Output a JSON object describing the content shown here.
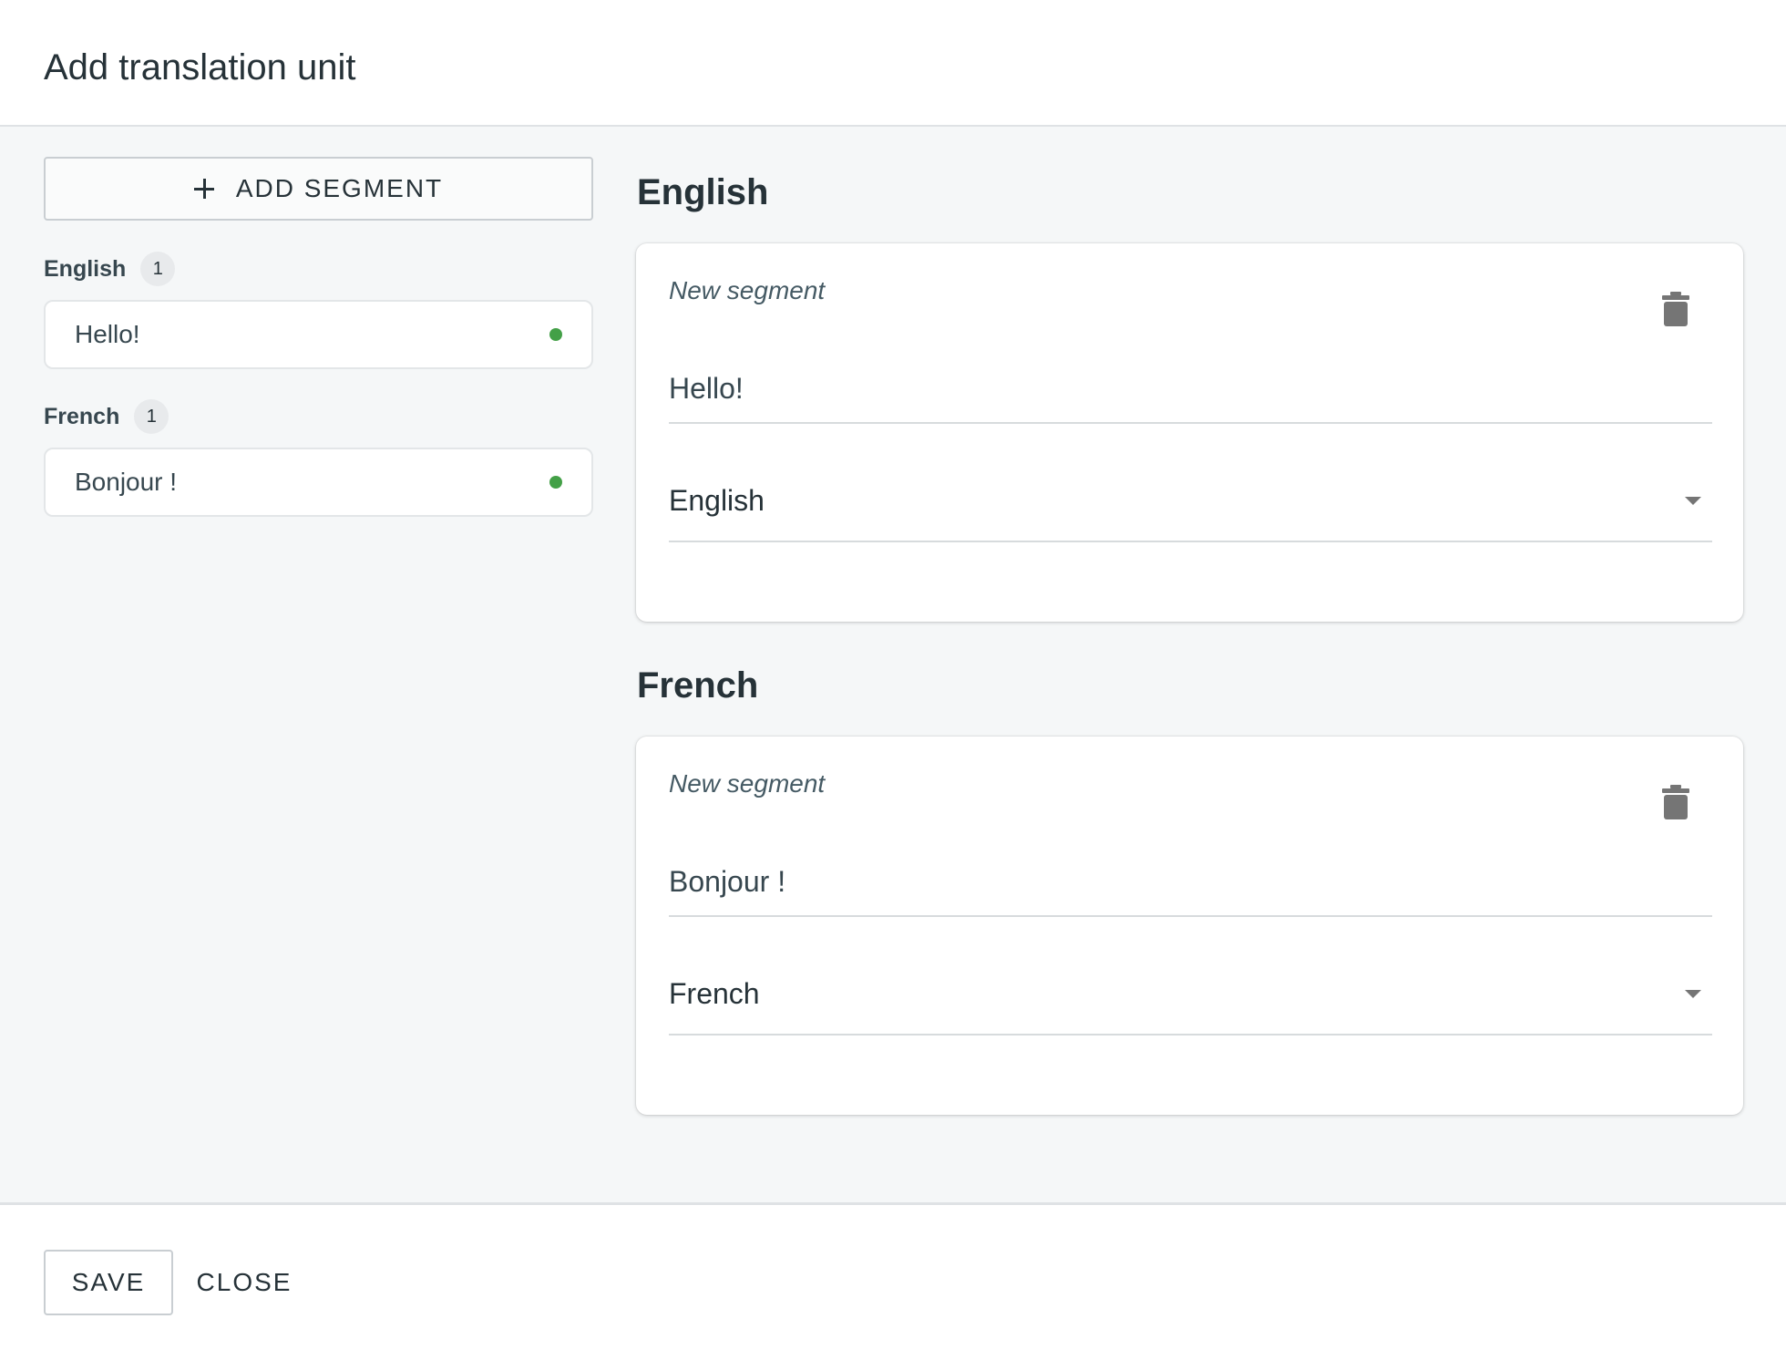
{
  "dialog": {
    "title": "Add translation unit"
  },
  "left_panel": {
    "add_segment_label": "ADD SEGMENT",
    "add_segment_icon": "plus-icon",
    "groups": [
      {
        "language": "English",
        "count": "1",
        "segments": [
          {
            "text": "Hello!",
            "status_color": "#43a047"
          }
        ]
      },
      {
        "language": "French",
        "count": "1",
        "segments": [
          {
            "text": "Bonjour !",
            "status_color": "#43a047"
          }
        ]
      }
    ]
  },
  "right_panel": {
    "sections": [
      {
        "title": "English",
        "card_label": "New segment",
        "delete_icon": "trash-icon",
        "text_value": "Hello!",
        "language_value": "English",
        "dropdown_icon": "caret-down-icon"
      },
      {
        "title": "French",
        "card_label": "New segment",
        "delete_icon": "trash-icon",
        "text_value": "Bonjour !",
        "language_value": "French",
        "dropdown_icon": "caret-down-icon"
      }
    ]
  },
  "footer": {
    "save_label": "SAVE",
    "close_label": "CLOSE"
  },
  "colors": {
    "accent_status": "#43a047",
    "body_background": "#f5f7f8",
    "text_primary": "#263238"
  }
}
